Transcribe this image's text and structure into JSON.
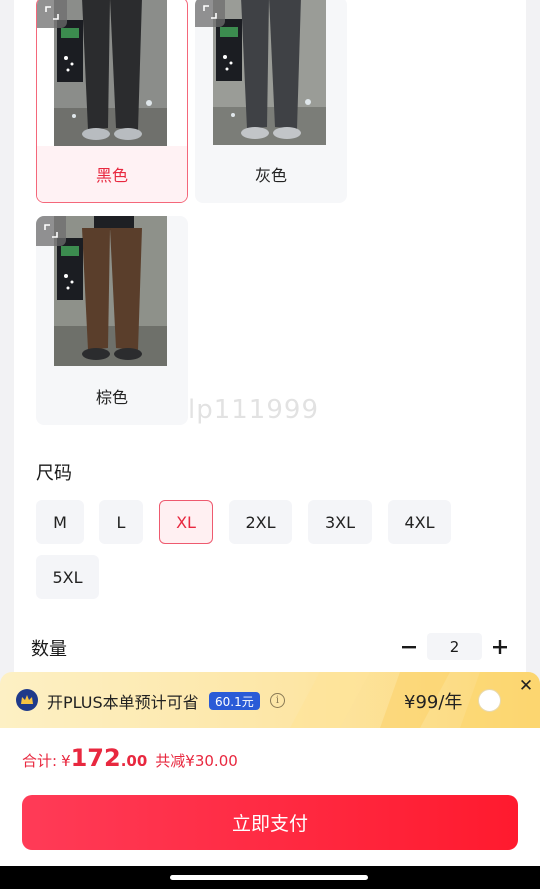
{
  "colors": {
    "options": [
      {
        "label": "黑色",
        "selected": true,
        "pant_color": "#2b2c2e"
      },
      {
        "label": "灰色",
        "selected": false,
        "pant_color": "#3f4145"
      },
      {
        "label": "棕色",
        "selected": false,
        "pant_color": "#5a3e2b"
      }
    ]
  },
  "watermark": "lp111999",
  "size": {
    "title": "尺码",
    "options": [
      "M",
      "L",
      "XL",
      "2XL",
      "3XL",
      "4XL",
      "5XL"
    ],
    "selected": "XL"
  },
  "quantity": {
    "title": "数量",
    "value": "2",
    "minus_icon": "minus-icon",
    "plus_icon": "plus-icon"
  },
  "plus_banner": {
    "text": "开PLUS本单预计可省",
    "badge": "60.1元",
    "info": "i",
    "price": "¥99/年",
    "close": "✕"
  },
  "total": {
    "label": "合计:",
    "currency": "¥",
    "integer": "172",
    "decimal": ".00",
    "saved": "共减¥30.00"
  },
  "pay_button": "立即支付",
  "accent_color": "#e8283f"
}
